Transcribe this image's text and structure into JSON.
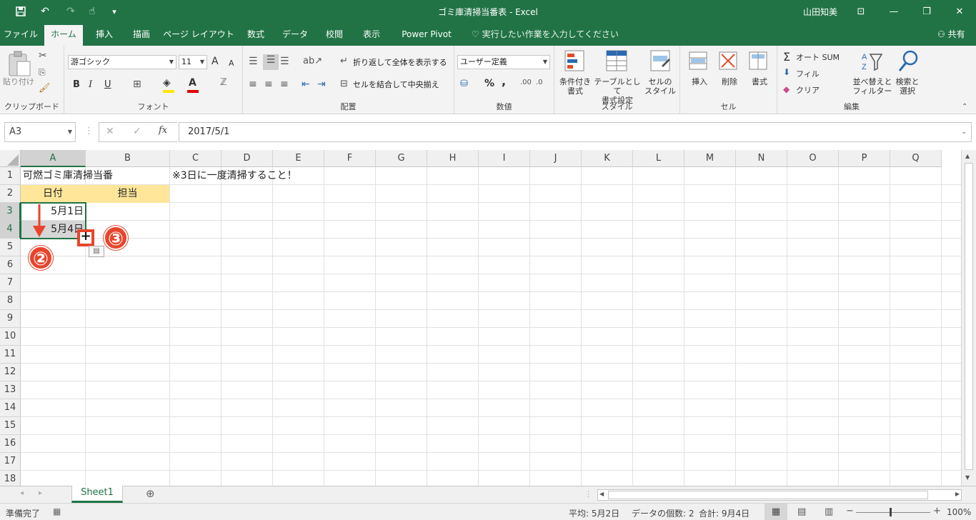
{
  "titlebar": {
    "title": "ゴミ庫清掃当番表 - Excel",
    "user": "山田知美",
    "qat": {
      "save": "🖫",
      "undo": "↶",
      "redo": "↷",
      "touch": "☝",
      "more": "▾"
    },
    "controls": {
      "ribbon_opts": "⊡",
      "minimize": "—",
      "restore": "❐",
      "close": "✕"
    }
  },
  "tabs": [
    "ファイル",
    "ホーム",
    "挿入",
    "描画",
    "ページ レイアウト",
    "数式",
    "データ",
    "校閲",
    "表示",
    "Power Pivot"
  ],
  "active_tab": "ホーム",
  "tellme": "実行したい作業を入力してください",
  "share": "共有",
  "ribbon": {
    "clipboard": {
      "label": "クリップボード",
      "paste": "貼り付け"
    },
    "font": {
      "label": "フォント",
      "name": "游ゴシック",
      "size": "11",
      "bold": "B",
      "italic": "I",
      "underline": "U",
      "grow": "A",
      "shrink": "A"
    },
    "alignment": {
      "label": "配置",
      "wrap": "折り返して全体を表示する",
      "merge": "セルを結合して中央揃え"
    },
    "number": {
      "label": "数値",
      "format": "ユーザー定義",
      "percent": "%",
      "comma": ","
    },
    "styles": {
      "label": "スタイル",
      "conditional": [
        "条件付き",
        "書式"
      ],
      "table": [
        "テーブルとして",
        "書式設定"
      ],
      "cell": [
        "セルの",
        "スタイル"
      ]
    },
    "cells": {
      "label": "セル",
      "insert": "挿入",
      "delete": "削除",
      "format": "書式"
    },
    "editing": {
      "label": "編集",
      "autosum": "オート SUM",
      "fill": "フィル",
      "clear": "クリア",
      "sort": [
        "並べ替えと",
        "フィルター"
      ],
      "find": [
        "検索と",
        "選択"
      ]
    }
  },
  "formula_bar": {
    "name_box": "A3",
    "cancel": "✕",
    "enter": "✓",
    "fx": "fx",
    "value": "2017/5/1"
  },
  "columns": [
    "A",
    "B",
    "C",
    "D",
    "E",
    "F",
    "G",
    "H",
    "I",
    "J",
    "K",
    "L",
    "M",
    "N",
    "O",
    "P",
    "Q"
  ],
  "rows": [
    "1",
    "2",
    "3",
    "4",
    "5",
    "6",
    "7",
    "8",
    "9",
    "10",
    "11",
    "12",
    "13",
    "14",
    "15",
    "16",
    "17",
    "18"
  ],
  "cells": {
    "A1": "可燃ゴミ庫清掃当番",
    "C1": "※3日に一度清掃すること！",
    "A2": "日付",
    "B2": "担当",
    "A3": "5月1日",
    "A4": "5月4日"
  },
  "annotations": {
    "step2": "②",
    "step3": "③"
  },
  "sheet": {
    "tab": "Sheet1",
    "add": "⊕"
  },
  "status": {
    "ready": "準備完了",
    "average": "平均: 5月2日",
    "count": "データの個数: 2",
    "sum": "合計: 9月4日",
    "zoom": "100%"
  },
  "colors": {
    "excel_green": "#217346",
    "header_fill": "#ffe699",
    "badge": "#e8452c"
  }
}
